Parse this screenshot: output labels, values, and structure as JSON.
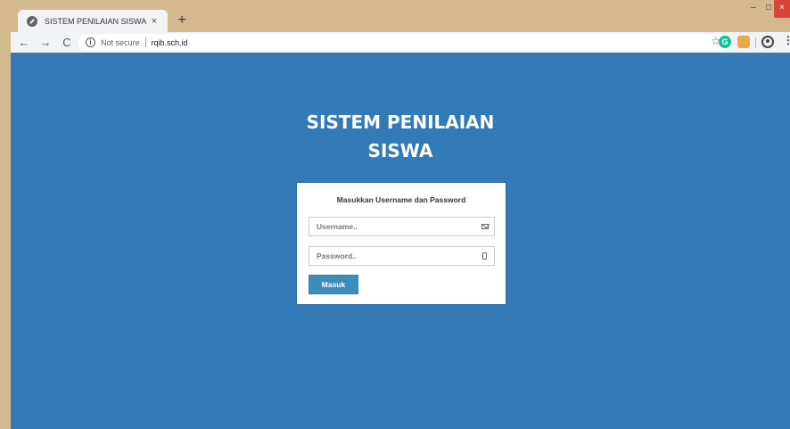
{
  "browser": {
    "tab_title": "SISTEM PENILAIAN SISWA",
    "tab_close": "×",
    "new_tab": "+",
    "window_controls": {
      "minimize": "–",
      "maximize": "□",
      "close": "×"
    },
    "nav": {
      "back": "←",
      "forward": "→",
      "reload": "C"
    },
    "security_icon": "i",
    "security_text": "Not secure",
    "url": "rqib.sch.id",
    "bookmark_icon": "☆",
    "extensions": [
      "G",
      "●"
    ],
    "menu": "⋮"
  },
  "page": {
    "heading_line1": "SISTEM PENILAIAN",
    "heading_line2": "SISWA",
    "background_color": "#337ab7"
  },
  "login": {
    "title": "Masukkan Username dan Password",
    "username_placeholder": "Username..",
    "password_placeholder": "Password..",
    "submit_label": "Masuk",
    "button_color": "#3c8dbc"
  }
}
